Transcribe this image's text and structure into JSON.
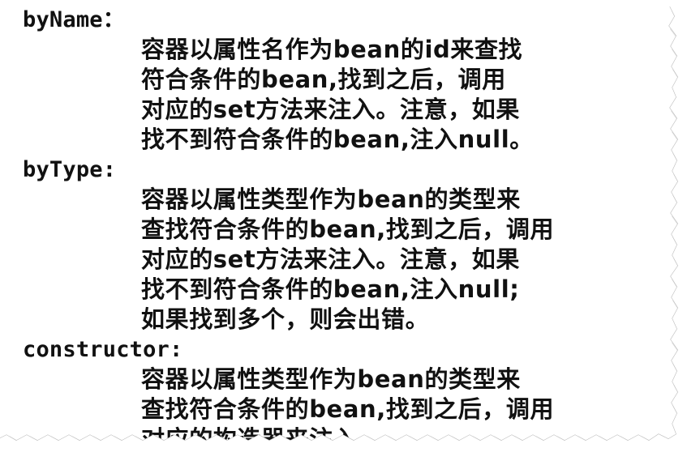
{
  "sections": [
    {
      "heading": "byName：",
      "lines": [
        "容器以属性名作为bean的id来查找",
        "符合条件的bean,找到之后，调用",
        "对应的set方法来注入。注意，如果",
        "找不到符合条件的bean,注入null。"
      ]
    },
    {
      "heading": "byType:",
      "lines": [
        "容器以属性类型作为bean的类型来",
        "查找符合条件的bean,找到之后，调用",
        "对应的set方法来注入。注意，如果",
        "找不到符合条件的bean,注入null;",
        "如果找到多个，则会出错。"
      ]
    },
    {
      "heading": "constructor:",
      "lines": [
        "容器以属性类型作为bean的类型来",
        "查找符合条件的bean,找到之后，调用",
        "对应的构造器来注入。"
      ]
    }
  ],
  "colors": {
    "text": "#111111",
    "paper": "#ffffff",
    "edge": "#bdbdbd",
    "shadow": "#9a9a9a"
  }
}
